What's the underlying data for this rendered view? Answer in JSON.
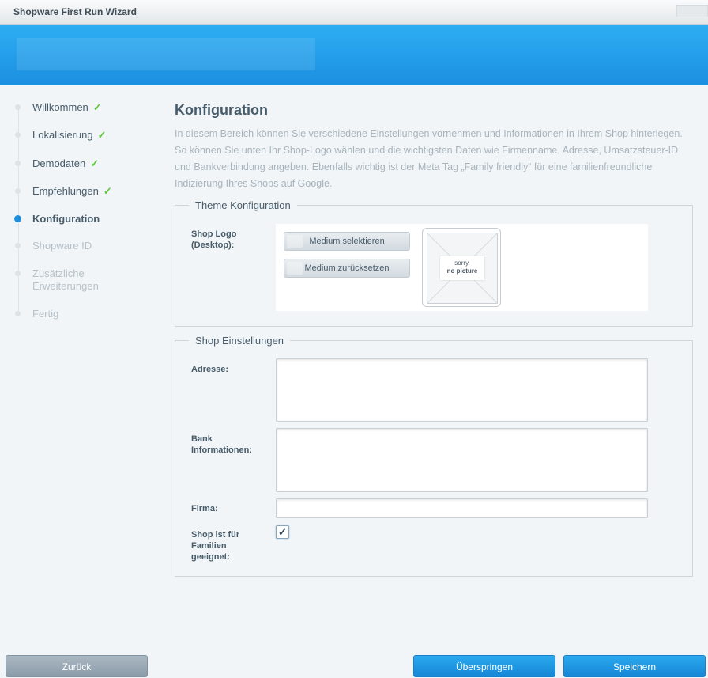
{
  "window": {
    "title": "Shopware First Run Wizard"
  },
  "sidebar": {
    "steps": [
      {
        "label": "Willkommen",
        "state": "done",
        "check": "✓"
      },
      {
        "label": "Lokalisierung",
        "state": "done",
        "check": "✓"
      },
      {
        "label": "Demodaten",
        "state": "done",
        "check": "✓"
      },
      {
        "label": "Empfehlungen",
        "state": "done",
        "check": "✓"
      },
      {
        "label": "Konfiguration",
        "state": "active"
      },
      {
        "label": "Shopware ID",
        "state": "future"
      },
      {
        "label": "Zusätzliche Erweiterungen",
        "state": "future"
      },
      {
        "label": "Fertig",
        "state": "future"
      }
    ]
  },
  "main": {
    "title": "Konfiguration",
    "intro": "In diesem Bereich können Sie verschiedene Einstellungen vornehmen und Informationen in Ihrem Shop hinterlegen. So können Sie unten Ihr Shop-Logo wählen und die wichtigsten Daten wie Firmenname, Adresse, Umsatzsteuer-ID und Bankverbindung angeben. Ebenfalls wichtig ist der Meta Tag „Family friendly“ für eine familienfreundliche Indizierung Ihres Shops auf Google."
  },
  "theme": {
    "legend": "Theme Konfiguration",
    "logo_label": "Shop Logo (Desktop):",
    "select_button": "Medium selektieren",
    "reset_button": "Medium zurücksetzen",
    "no_picture_line1": "sorry,",
    "no_picture_line2": "no picture"
  },
  "shop": {
    "legend": "Shop Einstellungen",
    "address_label": "Adresse:",
    "address_value": "",
    "bank_label": "Bank Informationen:",
    "bank_value": "",
    "company_label": "Firma:",
    "company_value": "",
    "family_label": "Shop ist für Familien geeignet:",
    "family_checked": true,
    "check_glyph": "✓"
  },
  "footer": {
    "back": "Zurück",
    "skip": "Überspringen",
    "save": "Speichern"
  },
  "colors": {
    "accent": "#1d8fdc",
    "check": "#5ec93a",
    "banner": "#2eaef3"
  },
  "icons": {
    "step_done": "check-icon",
    "active_step": "dot-icon",
    "no_picture": "image-placeholder-icon"
  }
}
